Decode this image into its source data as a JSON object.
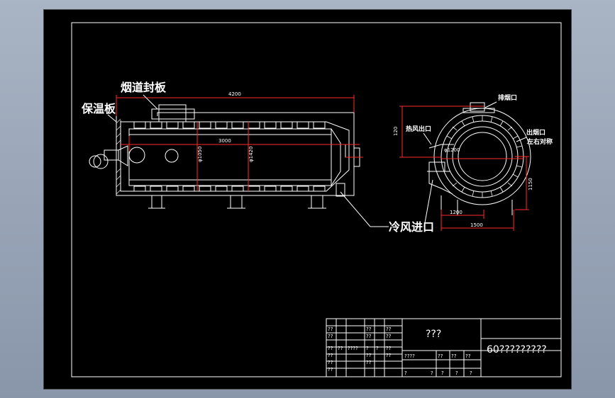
{
  "labels": {
    "flue_cover": "烟道封板",
    "insulation": "保温板",
    "cold_air_inlet": "冷风进口",
    "exhaust_outlet": "排烟口",
    "hot_air_outlet": "热风出口",
    "smoke_outlet": "出烟口",
    "symmetric": "左右对称"
  },
  "dimensions": {
    "total_length": "4200",
    "inner_length": "3000",
    "dia_inner": "φ1050",
    "dia_outer": "φ1420",
    "section_dia": "φ1200",
    "height_120": "120",
    "width_1200": "1200",
    "width_1500": "1500",
    "height_1150": "1150"
  },
  "title_block": {
    "drawing_title": "???",
    "drawing_number": "60?????????",
    "cells": [
      "??",
      "??",
      "????",
      "?",
      "?",
      "??",
      "??",
      "??",
      "??",
      "??",
      "??",
      "??",
      "????",
      "??",
      "??",
      "??",
      "?",
      "?",
      "?",
      "?",
      "?",
      "??",
      "??",
      "??",
      "??",
      "??",
      "??"
    ]
  }
}
